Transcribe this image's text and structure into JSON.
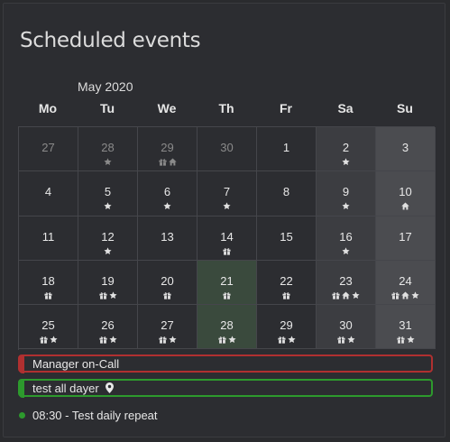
{
  "panel": {
    "title": "Scheduled events"
  },
  "calendar": {
    "month_label": "May 2020",
    "weekdays": [
      "Mo",
      "Tu",
      "We",
      "Th",
      "Fr",
      "Sa",
      "Su"
    ],
    "weeks": [
      [
        {
          "day": "27",
          "outside": true,
          "icons": []
        },
        {
          "day": "28",
          "outside": true,
          "icons": [
            "star-icon"
          ]
        },
        {
          "day": "29",
          "outside": true,
          "icons": [
            "gift-icon",
            "home-icon"
          ]
        },
        {
          "day": "30",
          "outside": true,
          "icons": []
        },
        {
          "day": "1",
          "icons": []
        },
        {
          "day": "2",
          "icons": [
            "star-icon"
          ]
        },
        {
          "day": "3",
          "icons": []
        }
      ],
      [
        {
          "day": "4",
          "icons": []
        },
        {
          "day": "5",
          "icons": [
            "star-icon"
          ]
        },
        {
          "day": "6",
          "icons": [
            "star-icon"
          ]
        },
        {
          "day": "7",
          "icons": [
            "star-icon"
          ]
        },
        {
          "day": "8",
          "icons": []
        },
        {
          "day": "9",
          "icons": [
            "star-icon"
          ]
        },
        {
          "day": "10",
          "icons": [
            "home-icon"
          ]
        }
      ],
      [
        {
          "day": "11",
          "icons": []
        },
        {
          "day": "12",
          "icons": [
            "star-icon"
          ]
        },
        {
          "day": "13",
          "icons": []
        },
        {
          "day": "14",
          "icons": [
            "gift-icon"
          ]
        },
        {
          "day": "15",
          "icons": []
        },
        {
          "day": "16",
          "icons": [
            "star-icon"
          ]
        },
        {
          "day": "17",
          "icons": []
        }
      ],
      [
        {
          "day": "18",
          "icons": [
            "gift-icon"
          ]
        },
        {
          "day": "19",
          "icons": [
            "gift-icon",
            "star-icon"
          ]
        },
        {
          "day": "20",
          "icons": [
            "gift-icon"
          ]
        },
        {
          "day": "21",
          "icons": [
            "gift-icon"
          ],
          "highlight": true
        },
        {
          "day": "22",
          "icons": [
            "gift-icon"
          ]
        },
        {
          "day": "23",
          "icons": [
            "gift-icon",
            "home-icon",
            "star-icon"
          ]
        },
        {
          "day": "24",
          "icons": [
            "gift-icon",
            "home-icon",
            "star-icon"
          ]
        }
      ],
      [
        {
          "day": "25",
          "icons": [
            "gift-icon",
            "star-icon"
          ]
        },
        {
          "day": "26",
          "icons": [
            "gift-icon",
            "star-icon"
          ]
        },
        {
          "day": "27",
          "icons": [
            "gift-icon",
            "star-icon"
          ]
        },
        {
          "day": "28",
          "icons": [
            "gift-icon",
            "star-icon"
          ],
          "highlight": true
        },
        {
          "day": "29",
          "icons": [
            "gift-icon",
            "star-icon"
          ]
        },
        {
          "day": "30",
          "icons": [
            "gift-icon",
            "star-icon"
          ]
        },
        {
          "day": "31",
          "icons": [
            "gift-icon",
            "star-icon"
          ]
        }
      ]
    ]
  },
  "events": [
    {
      "label": "Manager on-Call",
      "color": "#b03030",
      "icon": ""
    },
    {
      "label": "test all dayer",
      "color": "#2d9a2d",
      "icon": "map-pin-icon"
    }
  ],
  "timed_event": {
    "time_label": "08:30 - Test daily repeat",
    "dot_color": "#2d9a2d"
  },
  "colors": {
    "background": "#2c2d31",
    "weekend": "#3c3d41",
    "sunday": "#4b4c50",
    "today_column": "#3a4a3d"
  }
}
